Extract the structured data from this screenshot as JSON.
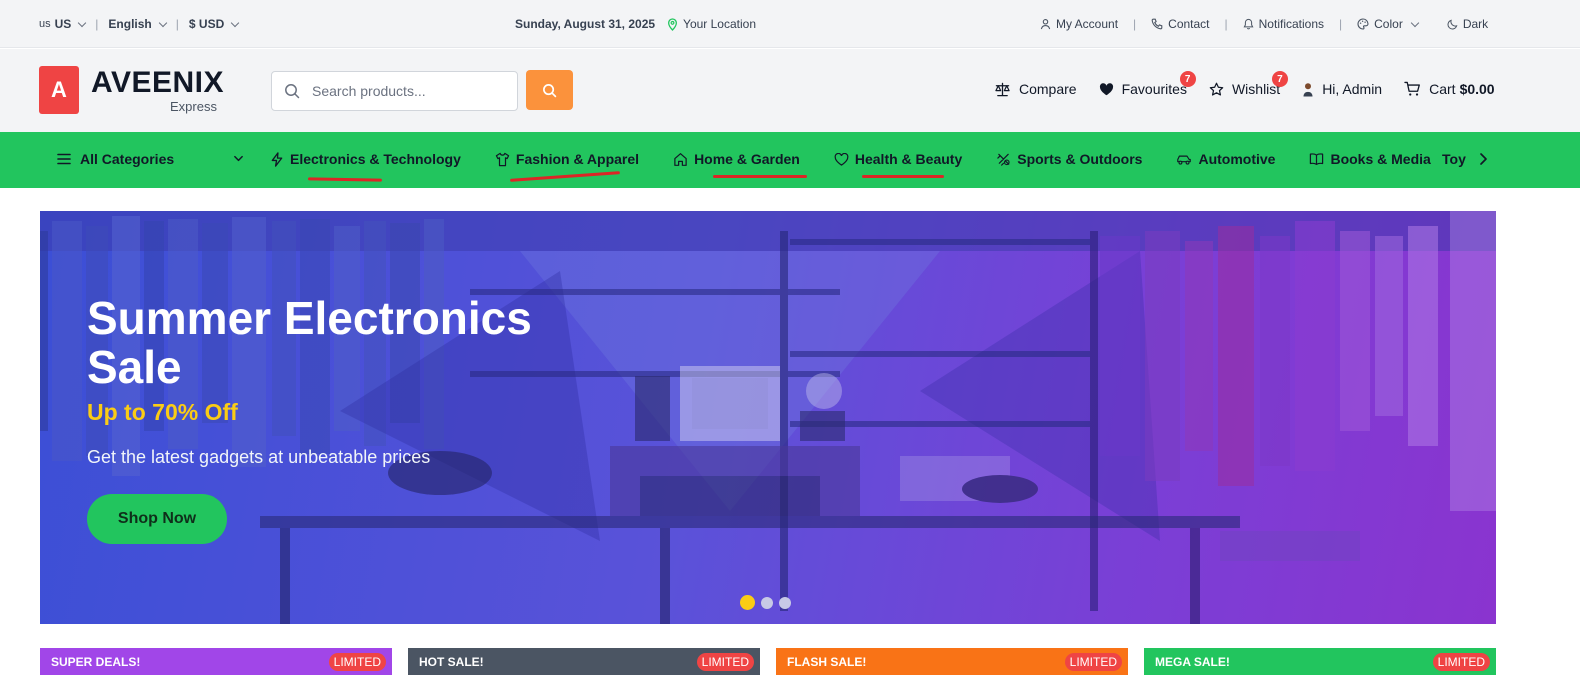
{
  "topbar": {
    "country_flag": "us",
    "country": "US",
    "language": "English",
    "currency": "$ USD",
    "date": "Sunday, August 31, 2025",
    "location": "Your Location",
    "my_account": "My Account",
    "contact": "Contact",
    "notifications": "Notifications",
    "color": "Color",
    "dark": "Dark"
  },
  "header": {
    "logo_letter": "A",
    "logo_name": "AVEENIX",
    "logo_sub": "Express",
    "search_placeholder": "Search products...",
    "compare": "Compare",
    "favourites": "Favourites",
    "favourites_count": "7",
    "wishlist": "Wishlist",
    "wishlist_count": "7",
    "greeting": "Hi, Admin",
    "cart_label": "Cart",
    "cart_total": "$0.00"
  },
  "nav": {
    "all_categories": "All Categories",
    "items": [
      {
        "label": "Electronics & Technology",
        "icon": "bolt-icon"
      },
      {
        "label": "Fashion & Apparel",
        "icon": "shirt-icon"
      },
      {
        "label": "Home & Garden",
        "icon": "home-icon"
      },
      {
        "label": "Health & Beauty",
        "icon": "heart-icon"
      },
      {
        "label": "Sports & Outdoors",
        "icon": "sports-icon"
      },
      {
        "label": "Automotive",
        "icon": "car-icon"
      },
      {
        "label": "Books & Media",
        "icon": "book-icon"
      }
    ],
    "clipped": "Toys"
  },
  "hero": {
    "title": "Summer Electronics Sale",
    "subtitle": "Up to 70% Off",
    "description": "Get the latest gadgets at unbeatable prices",
    "button": "Shop Now",
    "active_slide": 1,
    "slide_count": 3
  },
  "promos": [
    {
      "label": "SUPER DEALS!",
      "badge": "LIMITED",
      "color": "#a146e8"
    },
    {
      "label": "HOT SALE!",
      "badge": "LIMITED",
      "color": "#4b5563"
    },
    {
      "label": "FLASH SALE!",
      "badge": "LIMITED",
      "color": "#f97316"
    },
    {
      "label": "MEGA SALE!",
      "badge": "LIMITED",
      "color": "#22c55e"
    }
  ],
  "colors": {
    "brand_red": "#ef4444",
    "nav_green": "#22c55e",
    "search_orange": "#fb923c",
    "hero_accent": "#facc15"
  }
}
